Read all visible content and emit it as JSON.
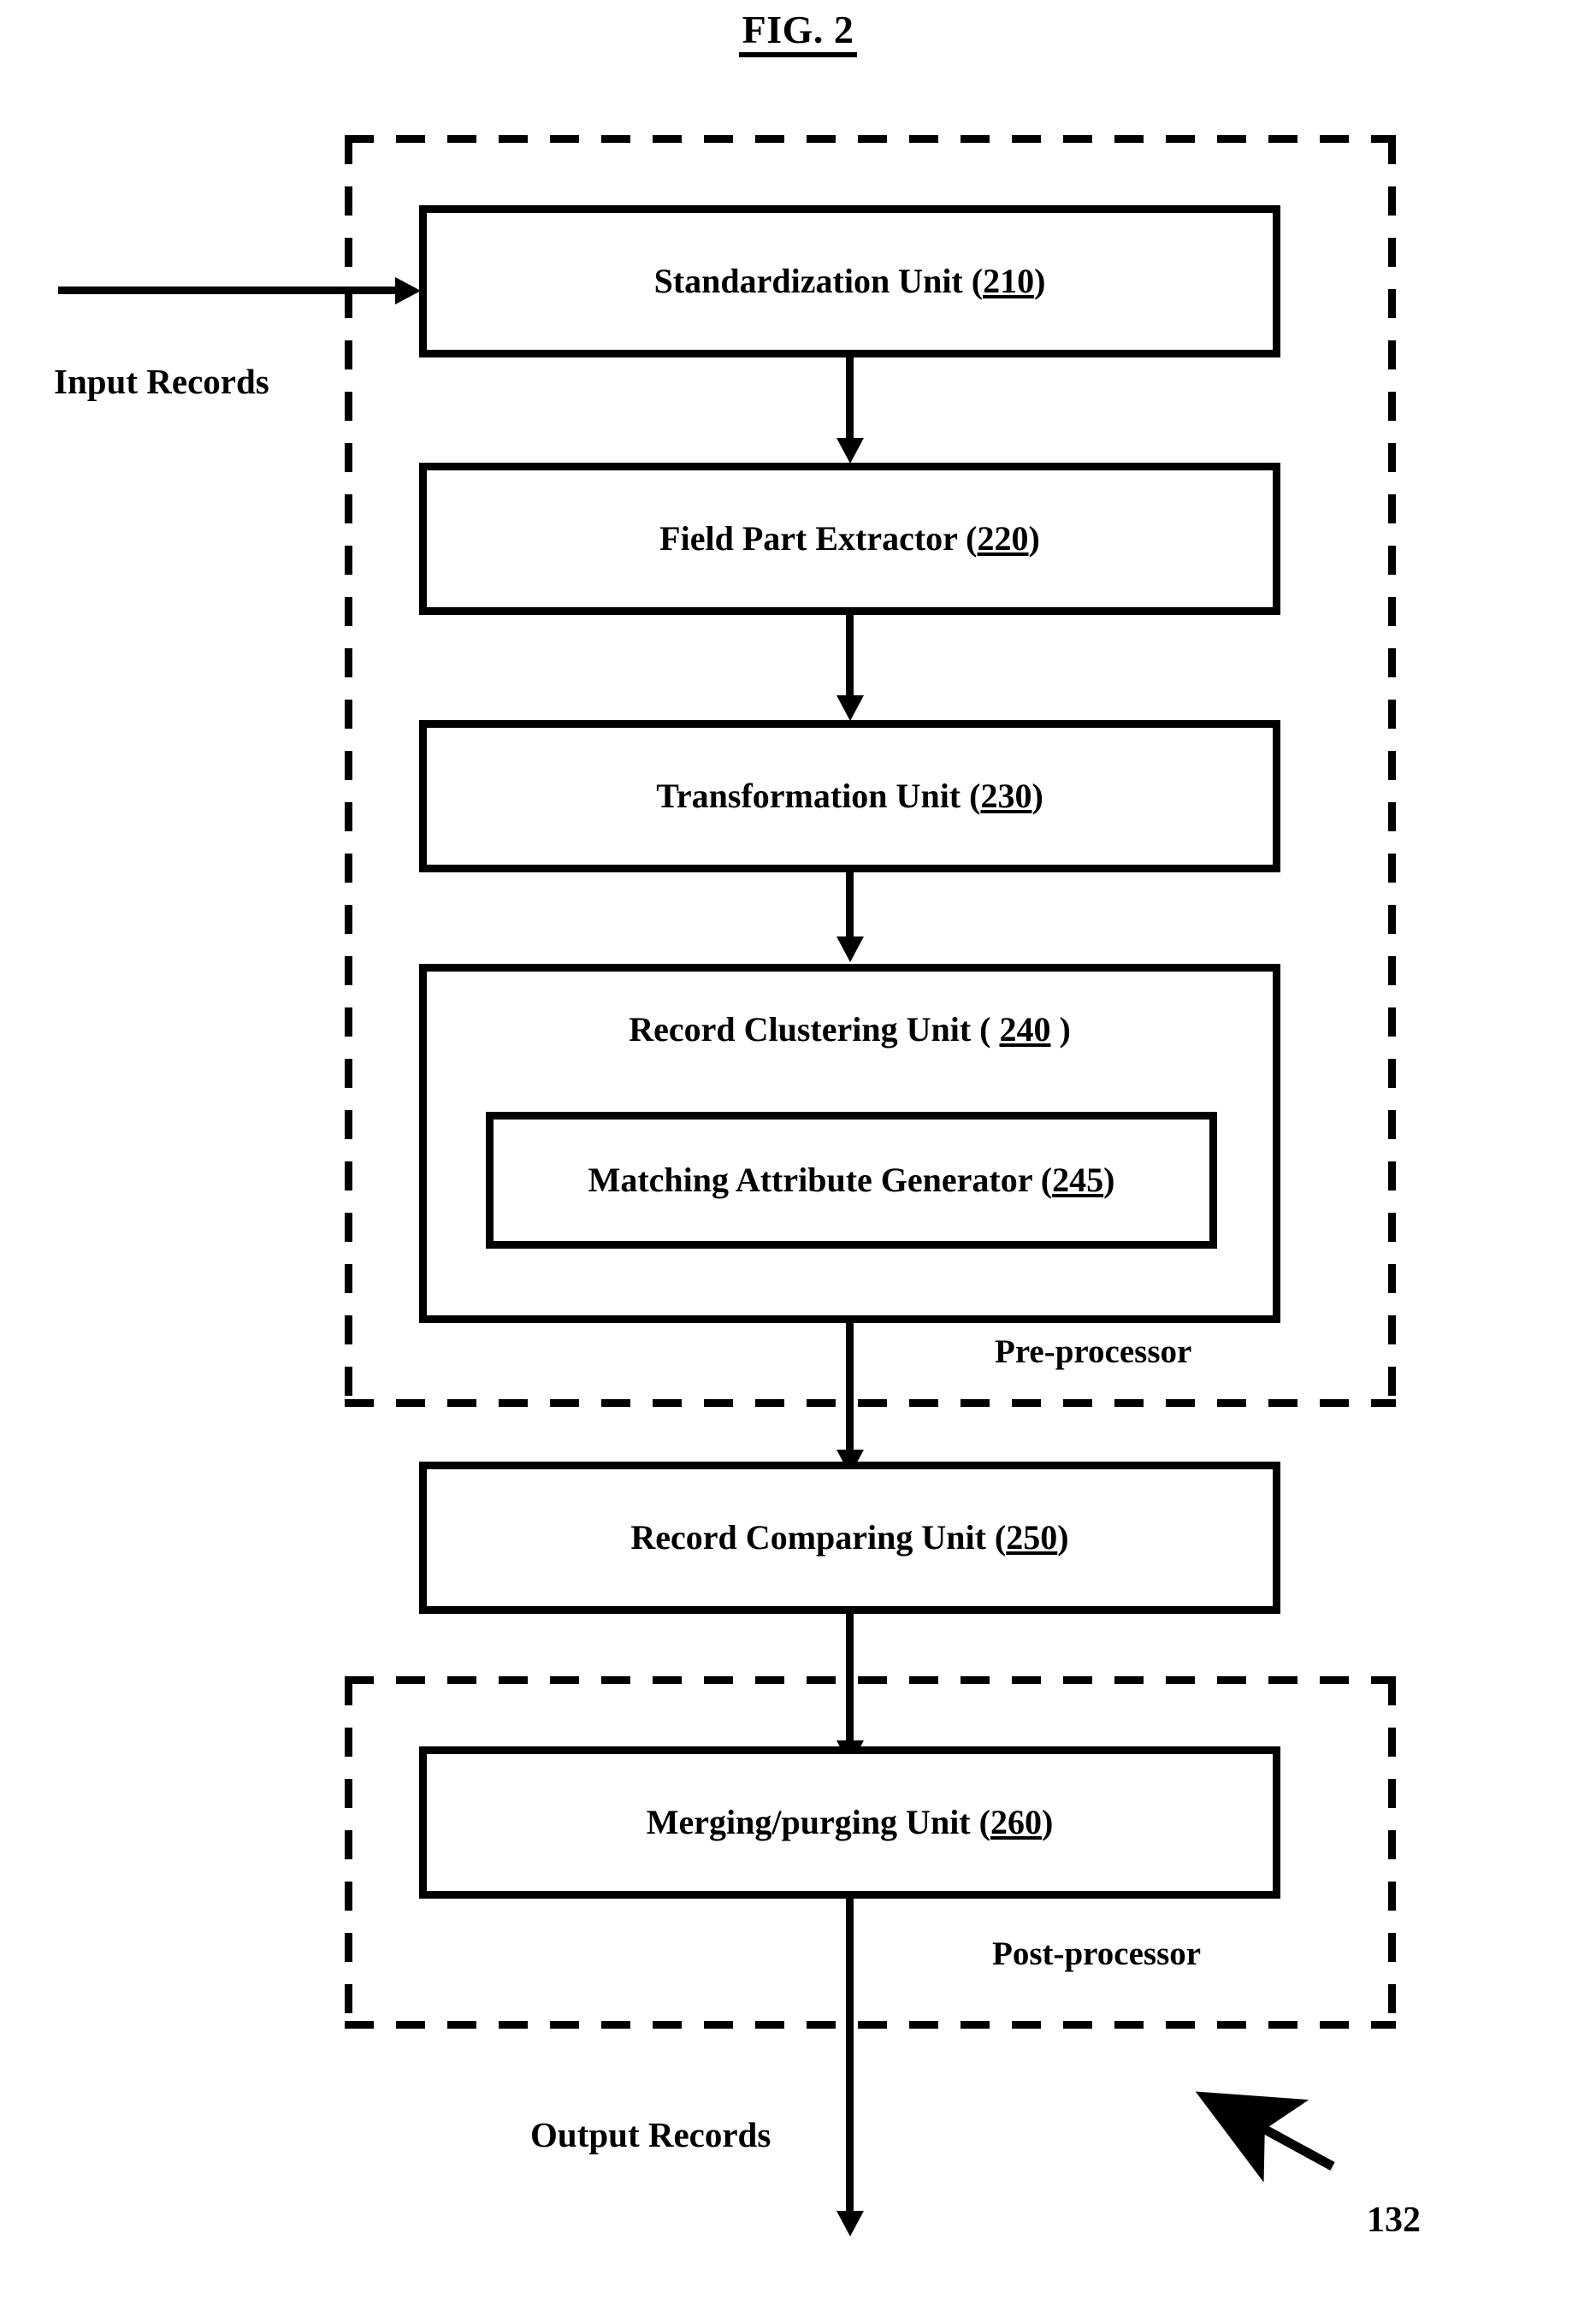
{
  "figure": {
    "title": "FIG. 2",
    "reference_numeral": "132"
  },
  "flow_labels": {
    "input": "Input Records",
    "output": "Output Records"
  },
  "groups": [
    {
      "id": "pre-processor",
      "label": "Pre-processor",
      "border_style": "dashed"
    },
    {
      "id": "post-processor",
      "label": "Post-processor",
      "border_style": "dashed"
    }
  ],
  "blocks": [
    {
      "id": "standardization-unit",
      "name": "Standardization Unit",
      "ref": "210",
      "prefix": "Standardization Unit (",
      "suffix": ")"
    },
    {
      "id": "field-part-extractor",
      "name": "Field Part Extractor",
      "ref": "220",
      "prefix": "Field Part Extractor (",
      "suffix": ")"
    },
    {
      "id": "transformation-unit",
      "name": "Transformation Unit",
      "ref": "230",
      "prefix": "Transformation Unit (",
      "suffix": ")"
    },
    {
      "id": "record-clustering-unit",
      "name": "Record Clustering Unit",
      "ref": "240",
      "prefix": "Record Clustering Unit ( ",
      "suffix": " )"
    },
    {
      "id": "matching-attribute-generator",
      "name": "Matching Attribute Generator",
      "ref": "245",
      "prefix": "Matching Attribute Generator (",
      "suffix": ")"
    },
    {
      "id": "record-comparing-unit",
      "name": "Record Comparing Unit",
      "ref": "250",
      "prefix": "Record Comparing Unit (",
      "suffix": ")"
    },
    {
      "id": "merging-purging-unit",
      "name": "Merging/purging Unit",
      "ref": "260",
      "prefix": "Merging/purging Unit (",
      "suffix": ")"
    }
  ],
  "colors": {
    "ink": "#000000",
    "paper": "#ffffff"
  }
}
